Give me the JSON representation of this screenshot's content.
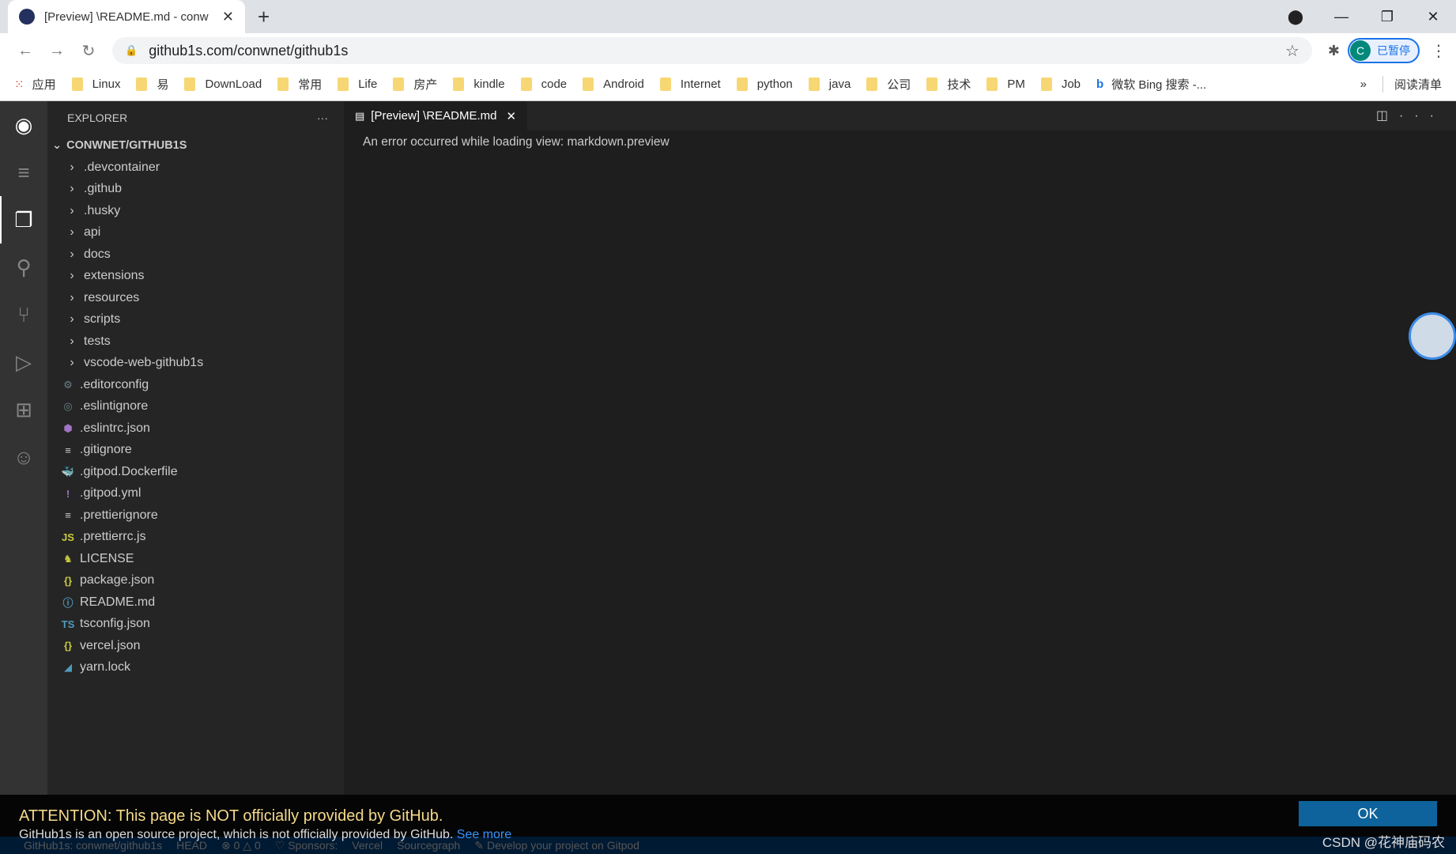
{
  "browser": {
    "tab_title": "[Preview] \\README.md - conw",
    "url": "github1s.com/conwnet/github1s",
    "profile_initial": "C",
    "profile_label": "已暂停",
    "bookmarks": [
      "应用",
      "Linux",
      "易",
      "DownLoad",
      "常用",
      "Life",
      "房产",
      "kindle",
      "code",
      "Android",
      "Internet",
      "python",
      "java",
      "公司",
      "技术",
      "PM",
      "Job",
      "微软 Bing 搜索 -..."
    ],
    "reading_list": "阅读清单"
  },
  "explorer": {
    "title": "EXPLORER",
    "root": "CONWNET/GITHUB1S",
    "folders": [
      ".devcontainer",
      ".github",
      ".husky",
      "api",
      "docs",
      "extensions",
      "resources",
      "scripts",
      "tests",
      "vscode-web-github1s"
    ],
    "files": [
      {
        "name": ".editorconfig",
        "icon": "⚙",
        "color": "#6d8086"
      },
      {
        "name": ".eslintignore",
        "icon": "◎",
        "color": "#6d8086"
      },
      {
        "name": ".eslintrc.json",
        "icon": "⬢",
        "color": "#a074c4"
      },
      {
        "name": ".gitignore",
        "icon": "≡",
        "color": "#ccc"
      },
      {
        "name": ".gitpod.Dockerfile",
        "icon": "🐳",
        "color": "#519aba"
      },
      {
        "name": ".gitpod.yml",
        "icon": "!",
        "color": "#a074c4"
      },
      {
        "name": ".prettierignore",
        "icon": "≡",
        "color": "#ccc"
      },
      {
        "name": ".prettierrc.js",
        "icon": "JS",
        "color": "#cbcb41"
      },
      {
        "name": "LICENSE",
        "icon": "♞",
        "color": "#cbcb41"
      },
      {
        "name": "package.json",
        "icon": "{}",
        "color": "#cbcb41"
      },
      {
        "name": "README.md",
        "icon": "ⓘ",
        "color": "#519aba"
      },
      {
        "name": "tsconfig.json",
        "icon": "TS",
        "color": "#519aba"
      },
      {
        "name": "vercel.json",
        "icon": "{}",
        "color": "#cbcb41"
      },
      {
        "name": "yarn.lock",
        "icon": "◢",
        "color": "#519aba"
      }
    ]
  },
  "editor": {
    "tab_label": "[Preview] \\README.md",
    "error": "An error occurred while loading view: markdown.preview"
  },
  "status": [
    "GitHub1s: conwnet/github1s",
    "HEAD",
    "⊗ 0 △ 0",
    "♡ Sponsors:",
    "Vercel",
    "Sourcegraph",
    "✎ Develop your project on Gitpod"
  ],
  "banner": {
    "title": "ATTENTION: This page is NOT officially provided by GitHub.",
    "text": "GitHub1s is an open source project, which is not officially provided by GitHub.",
    "link": "See more",
    "ok": "OK",
    "watermark": "CSDN @花神庙码农"
  }
}
